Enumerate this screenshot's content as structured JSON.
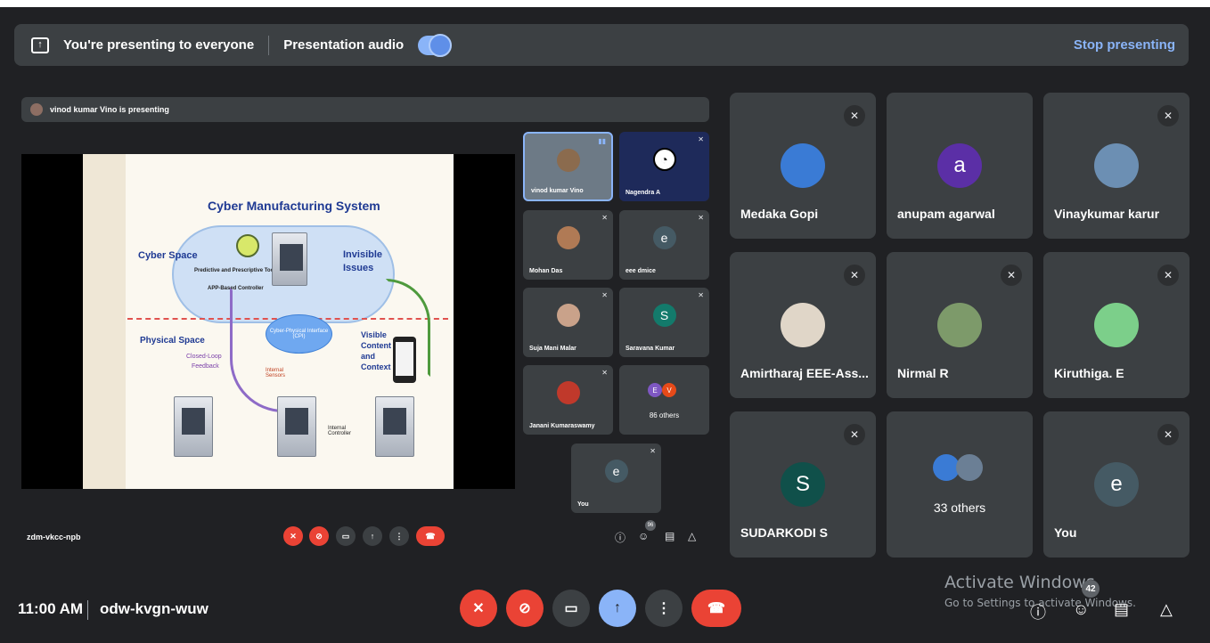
{
  "presenting_bar": {
    "message": "You're presenting to everyone",
    "audio_label": "Presentation audio",
    "audio_on": true,
    "stop_label": "Stop presenting"
  },
  "inner_meeting": {
    "banner": "vinod kumar Vino is presenting",
    "slide": {
      "title": "Cyber Manufacturing System",
      "cyber_space": "Cyber Space",
      "invisible": "Invisible",
      "issues": "Issues",
      "tools": "Predictive and Prescriptive Tools",
      "controller": "APP-Based Controller",
      "physical_space": "Physical Space",
      "closed_loop": "Closed-Loop",
      "feedback": "Feedback",
      "cpi": "Cyber-Physical Interface (CPI)",
      "visible": "Visible",
      "content": "Content",
      "and": "and",
      "context": "Context",
      "internal_sensors": "Internal Sensors",
      "internal_controller": "Internal Controller"
    },
    "tiles": [
      {
        "name": "vinod kumar Vino"
      },
      {
        "name": "Nagendra A"
      },
      {
        "name": "Mohan Das"
      },
      {
        "name": "eee dmice",
        "letter": "e"
      },
      {
        "name": "Suja Mani Malar"
      },
      {
        "name": "Saravana Kumar",
        "letter": "S"
      },
      {
        "name": "Janani Kumaraswamy"
      },
      {
        "name": "86 others",
        "letters": [
          "E",
          "V"
        ]
      },
      {
        "name": "You",
        "letter": "e"
      }
    ],
    "meeting_code": "zdm-vkcc-npb",
    "people_count": "96"
  },
  "grid": [
    {
      "name": "Medaka Gopi"
    },
    {
      "name": "anupam agarwal",
      "letter": "a",
      "color": "#5b2fa6"
    },
    {
      "name": "Vinaykumar karur"
    },
    {
      "name": "Amirtharaj EEE-Ass..."
    },
    {
      "name": "Nirmal R"
    },
    {
      "name": "Kiruthiga. E"
    },
    {
      "name": "SUDARKODI S",
      "letter": "S",
      "color": "#10504a"
    },
    {
      "name": "33 others"
    },
    {
      "name": "You",
      "letter": "e",
      "color": "#455a64"
    }
  ],
  "bottom_bar": {
    "time": "11:00 AM",
    "meeting_code": "odw-kvgn-wuw",
    "people_count": "42"
  },
  "watermark": {
    "line1": "Activate Windows",
    "line2": "Go to Settings to activate Windows."
  }
}
